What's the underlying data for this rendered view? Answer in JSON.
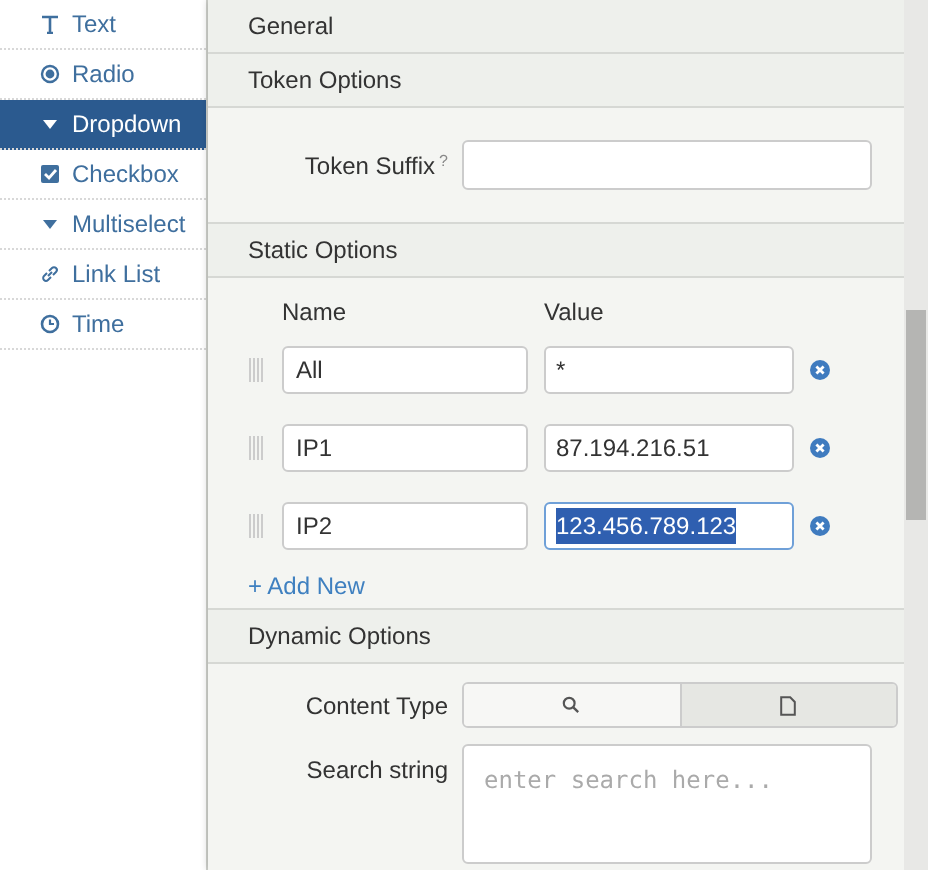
{
  "sidebar": {
    "items": [
      {
        "label": "Text",
        "kind": "text",
        "selected": false
      },
      {
        "label": "Radio",
        "kind": "radio",
        "selected": false
      },
      {
        "label": "Dropdown",
        "kind": "dropdown",
        "selected": true
      },
      {
        "label": "Checkbox",
        "kind": "checkbox",
        "selected": false
      },
      {
        "label": "Multiselect",
        "kind": "multiselect",
        "selected": false
      },
      {
        "label": "Link List",
        "kind": "linklist",
        "selected": false
      },
      {
        "label": "Time",
        "kind": "time",
        "selected": false
      }
    ]
  },
  "sections": {
    "general": "General",
    "token_options": "Token Options",
    "token_suffix": {
      "label": "Token Suffix",
      "help": "?"
    },
    "static_options": "Static Options",
    "dynamic_options": "Dynamic Options"
  },
  "static_options": {
    "columns": [
      "Name",
      "Value"
    ],
    "rows": [
      {
        "name": "All",
        "value": "*",
        "highlighted": false
      },
      {
        "name": "IP1",
        "value": "87.194.216.51",
        "highlighted": false
      },
      {
        "name": "IP2",
        "value": "123.456.789.123",
        "highlighted": true
      }
    ],
    "add_new": "+ Add New"
  },
  "dynamic_options": {
    "content_type": {
      "label": "Content Type",
      "options": [
        {
          "kind": "search",
          "selected": true
        },
        {
          "kind": "file",
          "selected": false
        }
      ]
    },
    "search_string": {
      "label": "Search string",
      "placeholder": "enter search here..."
    }
  }
}
